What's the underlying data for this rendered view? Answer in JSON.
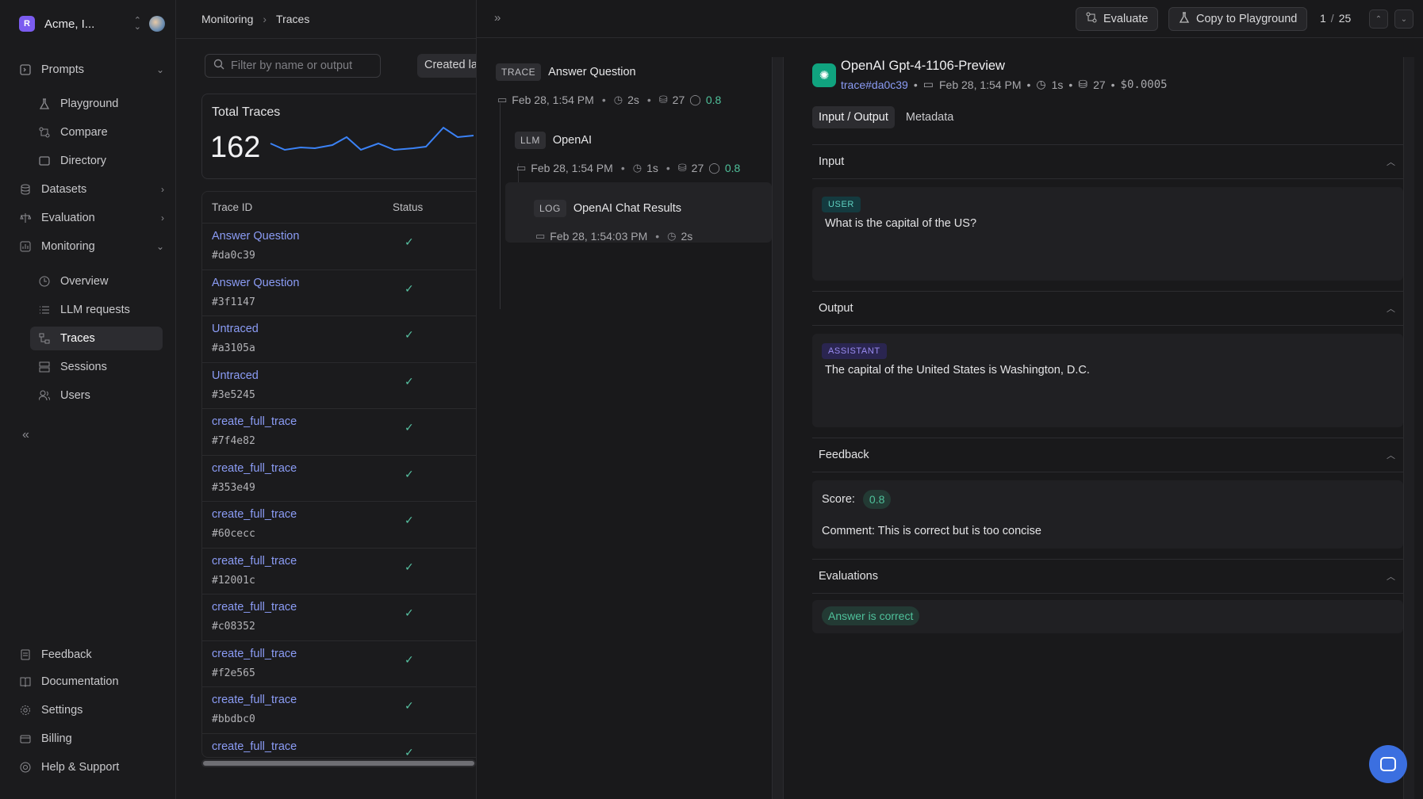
{
  "sidebar": {
    "org_name": "Acme, I...",
    "nav": [
      {
        "label": "Prompts",
        "icon": "prompt-icon",
        "chev": "⌄"
      },
      {
        "label": "Playground",
        "icon": "flask-icon",
        "sub": true
      },
      {
        "label": "Compare",
        "icon": "compare-icon",
        "sub": true
      },
      {
        "label": "Directory",
        "icon": "folder-icon",
        "sub": true
      },
      {
        "label": "Datasets",
        "icon": "database-icon",
        "chev": "›"
      },
      {
        "label": "Evaluation",
        "icon": "scale-icon",
        "chev": "›"
      },
      {
        "label": "Monitoring",
        "icon": "chart-icon",
        "chev": "⌄"
      },
      {
        "label": "Overview",
        "icon": "clock-icon",
        "sub": true
      },
      {
        "label": "LLM requests",
        "icon": "list-icon",
        "sub": true
      },
      {
        "label": "Traces",
        "icon": "trace-icon",
        "sub": true,
        "active": true
      },
      {
        "label": "Sessions",
        "icon": "sessions-icon",
        "sub": true
      },
      {
        "label": "Users",
        "icon": "users-icon",
        "sub": true
      }
    ],
    "bottom": [
      {
        "label": "Feedback",
        "icon": "feedback-icon"
      },
      {
        "label": "Documentation",
        "icon": "book-icon"
      },
      {
        "label": "Settings",
        "icon": "gear-icon"
      },
      {
        "label": "Billing",
        "icon": "billing-icon"
      },
      {
        "label": "Help & Support",
        "icon": "help-icon"
      }
    ]
  },
  "list": {
    "breadcrumb": [
      "Monitoring",
      "Traces"
    ],
    "search_placeholder": "Filter by name or output",
    "created_label": "Created la",
    "total_title": "Total Traces",
    "total_value": "162",
    "col_trace_id": "Trace ID",
    "col_status": "Status",
    "rows": [
      {
        "name": "Answer Question",
        "hash": "#da0c39"
      },
      {
        "name": "Answer Question",
        "hash": "#3f1147"
      },
      {
        "name": "Untraced",
        "hash": "#a3105a"
      },
      {
        "name": "Untraced",
        "hash": "#3e5245"
      },
      {
        "name": "create_full_trace",
        "hash": "#7f4e82"
      },
      {
        "name": "create_full_trace",
        "hash": "#353e49"
      },
      {
        "name": "create_full_trace",
        "hash": "#60cecc"
      },
      {
        "name": "create_full_trace",
        "hash": "#12001c"
      },
      {
        "name": "create_full_trace",
        "hash": "#c08352"
      },
      {
        "name": "create_full_trace",
        "hash": "#f2e565"
      },
      {
        "name": "create_full_trace",
        "hash": "#bbdbc0"
      },
      {
        "name": "create_full_trace",
        "hash": ""
      }
    ]
  },
  "panel": {
    "evaluate_label": "Evaluate",
    "copy_label": "Copy to Playground",
    "page_current": "1",
    "page_sep": "/",
    "page_total": "25",
    "trace": {
      "badge": "TRACE",
      "title": "Answer Question",
      "date": "Feb 28, 1:54 PM",
      "duration": "2s",
      "tokens": "27",
      "score": "0.8"
    },
    "llm": {
      "badge": "LLM",
      "title": "OpenAI",
      "date": "Feb 28, 1:54 PM",
      "duration": "1s",
      "tokens": "27",
      "score": "0.8"
    },
    "log": {
      "badge": "LOG",
      "title": "OpenAI Chat Results",
      "date": "Feb 28, 1:54:03 PM",
      "duration": "2s"
    },
    "detail": {
      "title": "OpenAI Gpt-4-1106-Preview",
      "trace_link": "trace#da0c39",
      "date": "Feb 28, 1:54 PM",
      "duration": "1s",
      "tokens": "27",
      "cost": "$0.0005",
      "tab_io": "Input / Output",
      "tab_meta": "Metadata",
      "input_h": "Input",
      "user_role": "USER",
      "user_msg": "What is the capital of the US?",
      "output_h": "Output",
      "assistant_role": "ASSISTANT",
      "assistant_msg": "The capital of the United States is Washington, D.C.",
      "feedback_h": "Feedback",
      "score_label": "Score:",
      "score_value": "0.8",
      "comment": "Comment: This is correct but is too concise",
      "evaluations_h": "Evaluations",
      "evaluation_pill": "Answer is correct"
    }
  }
}
